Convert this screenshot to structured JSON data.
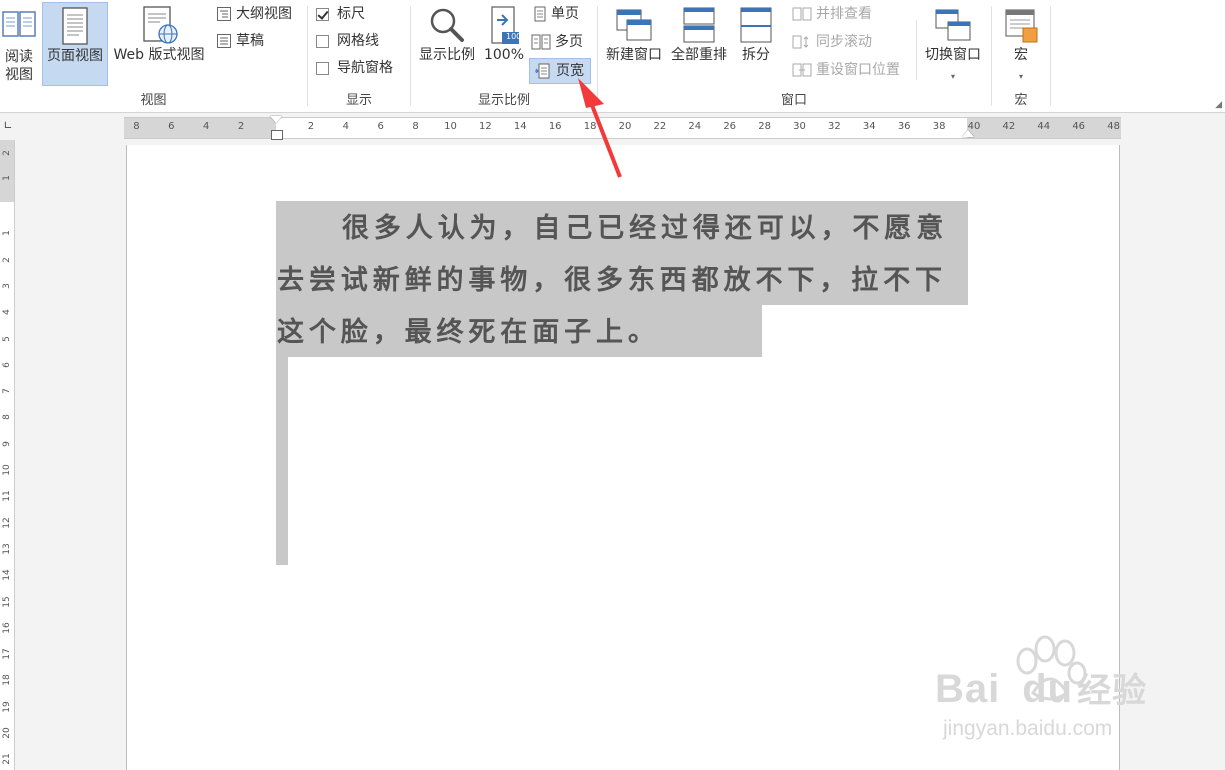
{
  "ribbon": {
    "view_group": {
      "label": "视图",
      "read_mode": "阅读\n视图",
      "print_layout": "页面视图",
      "web_layout": "Web 版式视图",
      "outline": "大纲视图",
      "draft": "草稿"
    },
    "show_group": {
      "label": "显示",
      "ruler": "标尺",
      "ruler_checked": true,
      "gridlines": "网格线",
      "gridlines_checked": false,
      "nav_pane": "导航窗格",
      "nav_pane_checked": false
    },
    "zoom_group": {
      "label": "显示比例",
      "zoom": "显示比例",
      "hundred": "100%",
      "hundred_badge": "100",
      "one_page": "单页",
      "multi_page": "多页",
      "page_width": "页宽"
    },
    "window_group": {
      "label": "窗口",
      "new_window": "新建窗口",
      "arrange_all": "全部重排",
      "split": "拆分",
      "side_by_side": "并排查看",
      "sync_scroll": "同步滚动",
      "reset_position": "重设窗口位置",
      "switch_windows": "切换窗口"
    },
    "macro_group": {
      "label": "宏",
      "macros": "宏"
    }
  },
  "ruler": {
    "h_numbers": [
      "8",
      "6",
      "4",
      "2",
      "2",
      "4",
      "6",
      "8",
      "10",
      "12",
      "14",
      "16",
      "18",
      "20",
      "22",
      "24",
      "26",
      "28",
      "30",
      "32",
      "34",
      "36",
      "38",
      "40",
      "42",
      "44",
      "46",
      "48"
    ],
    "v_numbers": [
      "2",
      "1",
      "1",
      "2",
      "3",
      "4",
      "5",
      "6",
      "7",
      "8",
      "9",
      "10",
      "11",
      "12",
      "13",
      "14",
      "15",
      "16",
      "17",
      "18",
      "19",
      "20",
      "21"
    ]
  },
  "document": {
    "lines": [
      "很多人认为，自己已经过得还可以，不愿意",
      "去尝试新鲜的事物，很多东西都放不下，拉不下",
      "这个脸，最终死在面子上。"
    ]
  },
  "watermark": {
    "brand": "Bai",
    "brand2": "du",
    "brand_cn": "经验",
    "url": "jingyan.baidu.com"
  },
  "colors": {
    "selected_button": "#c5d9f1",
    "arrow": "#f23a3a",
    "highlight": "#c8c8c8"
  }
}
